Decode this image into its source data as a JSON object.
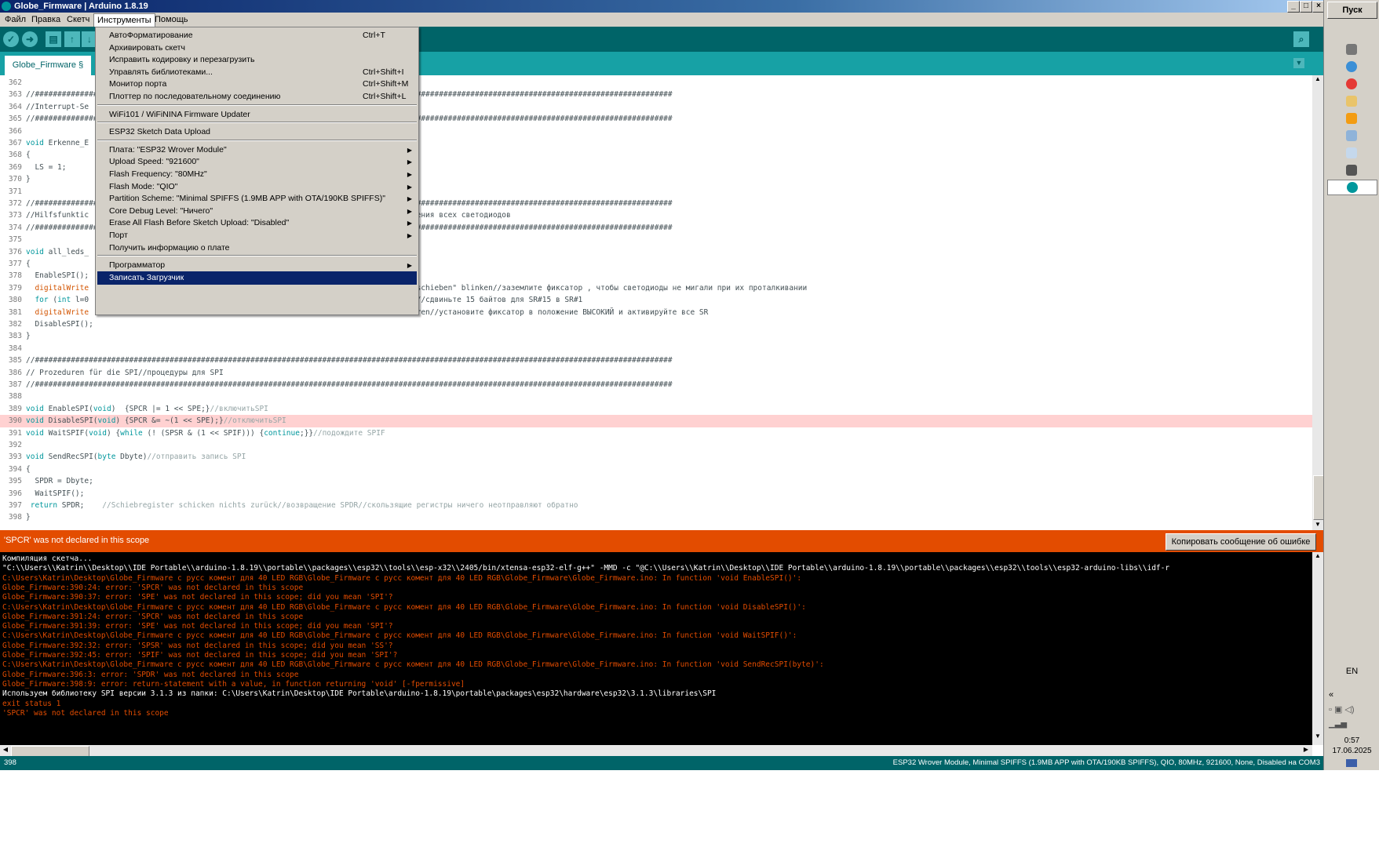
{
  "window": {
    "title": "Globe_Firmware | Arduino 1.8.19",
    "minimize": "_",
    "maximize": "□",
    "close": "×"
  },
  "menubar": [
    "Файл",
    "Правка",
    "Скетч",
    "Инструменты",
    "Помощь"
  ],
  "tab": {
    "label": "Globe_Firmware §"
  },
  "tools_menu": {
    "items": [
      {
        "label": "АвтоФорматирование",
        "shortcut": "Ctrl+T"
      },
      {
        "label": "Архивировать скетч",
        "shortcut": ""
      },
      {
        "label": "Исправить кодировку и перезагрузить",
        "shortcut": ""
      },
      {
        "label": "Управлять библиотеками...",
        "shortcut": "Ctrl+Shift+I"
      },
      {
        "label": "Монитор порта",
        "shortcut": "Ctrl+Shift+M"
      },
      {
        "label": "Плоттер по последовательному соединению",
        "shortcut": "Ctrl+Shift+L"
      },
      {
        "label": "WiFi101 / WiFiNINA Firmware Updater",
        "shortcut": ""
      },
      {
        "label": "ESP32 Sketch Data Upload",
        "shortcut": ""
      },
      {
        "label": "Плата: \"ESP32 Wrover Module\"",
        "submenu": true
      },
      {
        "label": "Upload Speed: \"921600\"",
        "submenu": true
      },
      {
        "label": "Flash Frequency: \"80MHz\"",
        "submenu": true
      },
      {
        "label": "Flash Mode: \"QIO\"",
        "submenu": true
      },
      {
        "label": "Partition Scheme: \"Minimal SPIFFS (1.9MB APP with OTA/190KB SPIFFS)\"",
        "submenu": true
      },
      {
        "label": "Core Debug Level: \"Ничего\"",
        "submenu": true
      },
      {
        "label": "Erase All Flash Before Sketch Upload: \"Disabled\"",
        "submenu": true
      },
      {
        "label": "Порт",
        "submenu": true
      },
      {
        "label": "Получить информацию о плате",
        "shortcut": ""
      },
      {
        "label": "Программатор",
        "submenu": true
      },
      {
        "label": "Записать Загрузчик",
        "selected": true
      }
    ]
  },
  "editor": {
    "lines": [
      {
        "n": "362",
        "parts": [
          {
            "t": "",
            "c": ""
          }
        ]
      },
      {
        "n": "363",
        "parts": [
          {
            "t": "//##############################################################################################################################################",
            "c": "cmr"
          }
        ]
      },
      {
        "n": "364",
        "parts": [
          {
            "t": "//Interrupt-Se",
            "c": "cmr"
          }
        ]
      },
      {
        "n": "365",
        "parts": [
          {
            "t": "//##############################################################################################################################################",
            "c": "cmr"
          }
        ]
      },
      {
        "n": "366",
        "parts": [
          {
            "t": "",
            "c": ""
          }
        ]
      },
      {
        "n": "367",
        "parts": [
          {
            "t": "void",
            "c": "kw"
          },
          {
            "t": " Erkenne_E",
            "c": ""
          }
        ]
      },
      {
        "n": "368",
        "parts": [
          {
            "t": "{",
            "c": ""
          }
        ]
      },
      {
        "n": "369",
        "parts": [
          {
            "t": "  LS = 1;",
            "c": ""
          }
        ]
      },
      {
        "n": "370",
        "parts": [
          {
            "t": "}",
            "c": ""
          }
        ]
      },
      {
        "n": "371",
        "parts": [
          {
            "t": "",
            "c": ""
          }
        ]
      },
      {
        "n": "372",
        "parts": [
          {
            "t": "//##############################################################################################################################################",
            "c": "cmr"
          }
        ]
      },
      {
        "n": "373",
        "parts": [
          {
            "t": "//Hilfsfunktic                                                                        нения всех светодиодов",
            "c": "cmr"
          }
        ]
      },
      {
        "n": "374",
        "parts": [
          {
            "t": "//##############################################################################################################################################",
            "c": "cmr"
          }
        ]
      },
      {
        "n": "375",
        "parts": [
          {
            "t": "",
            "c": ""
          }
        ]
      },
      {
        "n": "376",
        "parts": [
          {
            "t": "void",
            "c": "kw"
          },
          {
            "t": " all_leds_",
            "c": ""
          }
        ]
      },
      {
        "n": "377",
        "parts": [
          {
            "t": "{",
            "c": ""
          }
        ]
      },
      {
        "n": "378",
        "parts": [
          {
            "t": "  EnableSPI();",
            "c": ""
          }
        ]
      },
      {
        "n": "379",
        "parts": [
          {
            "t": "  digitalWrite",
            "c": "fn"
          },
          {
            "t": "                                                                   \"Durchschieben\" blinken//заземлите фиксатор , чтобы светодиоды не мигали при их проталкивании",
            "c": ""
          }
        ]
      },
      {
        "n": "380",
        "parts": [
          {
            "t": "  for",
            "c": "kw"
          },
          {
            "t": " (",
            "c": ""
          },
          {
            "t": "int",
            "c": "kw"
          },
          {
            "t": " l=0                                                                 schieben//сдвиньте 15 байтов для SR#15 в SR#1",
            "c": ""
          }
        ]
      },
      {
        "n": "381",
        "parts": [
          {
            "t": "  digitalWrite",
            "c": "fn"
          },
          {
            "t": "                                                                  aktivieren//установите фиксатор в положение ВЫСОКИЙ и активируйте все SR",
            "c": ""
          }
        ]
      },
      {
        "n": "382",
        "parts": [
          {
            "t": "  DisableSPI();",
            "c": ""
          }
        ]
      },
      {
        "n": "383",
        "parts": [
          {
            "t": "}",
            "c": ""
          }
        ]
      },
      {
        "n": "384",
        "parts": [
          {
            "t": "",
            "c": ""
          }
        ]
      },
      {
        "n": "385",
        "parts": [
          {
            "t": "//##############################################################################################################################################",
            "c": "cmr"
          }
        ]
      },
      {
        "n": "386",
        "parts": [
          {
            "t": "// Prozeduren für die SPI//процедуры для SPI",
            "c": "cmr"
          }
        ]
      },
      {
        "n": "387",
        "parts": [
          {
            "t": "//##############################################################################################################################################",
            "c": "cmr"
          }
        ]
      },
      {
        "n": "388",
        "parts": [
          {
            "t": "",
            "c": ""
          }
        ]
      },
      {
        "n": "389",
        "parts": [
          {
            "t": "void",
            "c": "kw"
          },
          {
            "t": " EnableSPI(",
            "c": ""
          },
          {
            "t": "void",
            "c": "kw"
          },
          {
            "t": ")  {SPCR |= 1 << SPE;}",
            "c": ""
          },
          {
            "t": "//включитьSPI",
            "c": "cm"
          }
        ]
      },
      {
        "n": "390",
        "hl": true,
        "parts": [
          {
            "t": "void",
            "c": "kw"
          },
          {
            "t": " DisableSPI(",
            "c": ""
          },
          {
            "t": "void",
            "c": "kw"
          },
          {
            "t": ") {SPCR &= ~(1 << SPE);}",
            "c": ""
          },
          {
            "t": "//отключитьSPI",
            "c": "cm"
          }
        ]
      },
      {
        "n": "391",
        "parts": [
          {
            "t": "void",
            "c": "kw"
          },
          {
            "t": " WaitSPIF(",
            "c": ""
          },
          {
            "t": "void",
            "c": "kw"
          },
          {
            "t": ") {",
            "c": ""
          },
          {
            "t": "while",
            "c": "kw"
          },
          {
            "t": " (! (SPSR & (1 << SPIF))) {",
            "c": ""
          },
          {
            "t": "continue",
            "c": "kw"
          },
          {
            "t": ";}}",
            "c": ""
          },
          {
            "t": "//подождите SPIF",
            "c": "cm"
          }
        ]
      },
      {
        "n": "392",
        "parts": [
          {
            "t": "",
            "c": ""
          }
        ]
      },
      {
        "n": "393",
        "parts": [
          {
            "t": "void",
            "c": "kw"
          },
          {
            "t": " SendRecSPI(",
            "c": ""
          },
          {
            "t": "byte",
            "c": "kw"
          },
          {
            "t": " Dbyte)",
            "c": ""
          },
          {
            "t": "//отправить запись SPI",
            "c": "cm"
          }
        ]
      },
      {
        "n": "394",
        "parts": [
          {
            "t": "{",
            "c": ""
          }
        ]
      },
      {
        "n": "395",
        "parts": [
          {
            "t": "  SPDR = Dbyte;",
            "c": ""
          }
        ]
      },
      {
        "n": "396",
        "parts": [
          {
            "t": "  WaitSPIF();",
            "c": ""
          }
        ]
      },
      {
        "n": "397",
        "parts": [
          {
            "t": " return",
            "c": "kw"
          },
          {
            "t": " SPDR;    ",
            "c": ""
          },
          {
            "t": "//Schiebregister schicken nichts zurück//возвращение SPDR//скользящие регистры ничего неотправляют обратно",
            "c": "cm"
          }
        ]
      },
      {
        "n": "398",
        "parts": [
          {
            "t": "}",
            "c": ""
          }
        ]
      }
    ]
  },
  "error_bar": {
    "message": "'SPCR' was not declared in this scope",
    "copy_button": "Копировать сообщение об ошибке"
  },
  "console": {
    "lines": [
      {
        "t": "Компиляция скетча...",
        "c": "w"
      },
      {
        "t": "\"C:\\\\Users\\\\Katrin\\\\Desktop\\\\IDE Portable\\\\arduino-1.8.19\\\\portable\\\\packages\\\\esp32\\\\tools\\\\esp-x32\\\\2405/bin/xtensa-esp32-elf-g++\" -MMD -c \"@C:\\\\Users\\\\Katrin\\\\Desktop\\\\IDE Portable\\\\arduino-1.8.19\\\\portable\\\\packages\\\\esp32\\\\tools\\\\esp32-arduino-libs\\\\idf-r",
        "c": "w"
      },
      {
        "t": "C:\\Users\\Katrin\\Desktop\\Globe_Firmware с русс комент для 40 LED RGB\\Globe_Firmware с русс комент для 40 LED RGB\\Globe_Firmware\\Globe_Firmware.ino: In function 'void EnableSPI()':",
        "c": "r"
      },
      {
        "t": "Globe_Firmware:390:24: error: 'SPCR' was not declared in this scope",
        "c": "r"
      },
      {
        "t": "Globe_Firmware:390:37: error: 'SPE' was not declared in this scope; did you mean 'SPI'?",
        "c": "r"
      },
      {
        "t": "C:\\Users\\Katrin\\Desktop\\Globe_Firmware с русс комент для 40 LED RGB\\Globe_Firmware с русс комент для 40 LED RGB\\Globe_Firmware\\Globe_Firmware.ino: In function 'void DisableSPI()':",
        "c": "r"
      },
      {
        "t": "Globe_Firmware:391:24: error: 'SPCR' was not declared in this scope",
        "c": "r"
      },
      {
        "t": "Globe_Firmware:391:39: error: 'SPE' was not declared in this scope; did you mean 'SPI'?",
        "c": "r"
      },
      {
        "t": "C:\\Users\\Katrin\\Desktop\\Globe_Firmware с русс комент для 40 LED RGB\\Globe_Firmware с русс комент для 40 LED RGB\\Globe_Firmware\\Globe_Firmware.ino: In function 'void WaitSPIF()':",
        "c": "r"
      },
      {
        "t": "Globe_Firmware:392:32: error: 'SPSR' was not declared in this scope; did you mean 'SS'?",
        "c": "r"
      },
      {
        "t": "Globe_Firmware:392:45: error: 'SPIF' was not declared in this scope; did you mean 'SPI'?",
        "c": "r"
      },
      {
        "t": "C:\\Users\\Katrin\\Desktop\\Globe_Firmware с русс комент для 40 LED RGB\\Globe_Firmware с русс комент для 40 LED RGB\\Globe_Firmware\\Globe_Firmware.ino: In function 'void SendRecSPI(byte)':",
        "c": "r"
      },
      {
        "t": "Globe_Firmware:396:3: error: 'SPDR' was not declared in this scope",
        "c": "r"
      },
      {
        "t": "Globe_Firmware:398:9: error: return-statement with a value, in function returning 'void' [-fpermissive]",
        "c": "r"
      },
      {
        "t": "Используем библиотеку SPI версии 3.1.3 из папки: C:\\Users\\Katrin\\Desktop\\IDE Portable\\arduino-1.8.19\\portable\\packages\\esp32\\hardware\\esp32\\3.1.3\\libraries\\SPI",
        "c": "w"
      },
      {
        "t": "exit status 1",
        "c": "r"
      },
      {
        "t": "'SPCR' was not declared in this scope",
        "c": "r"
      }
    ]
  },
  "statusbar": {
    "line": "398",
    "board": "ESP32 Wrover Module, Minimal SPIFFS (1.9MB APP with OTA/190KB SPIFFS), QIO, 80MHz, 921600, None, Disabled на COM3"
  },
  "desktop_panel": {
    "start": "Пуск",
    "lang": "EN",
    "time": "0:57",
    "date": "17.06.2025"
  },
  "colors": {
    "accent": "#00979c",
    "toolbar": "#006468",
    "error": "#e34c00"
  }
}
